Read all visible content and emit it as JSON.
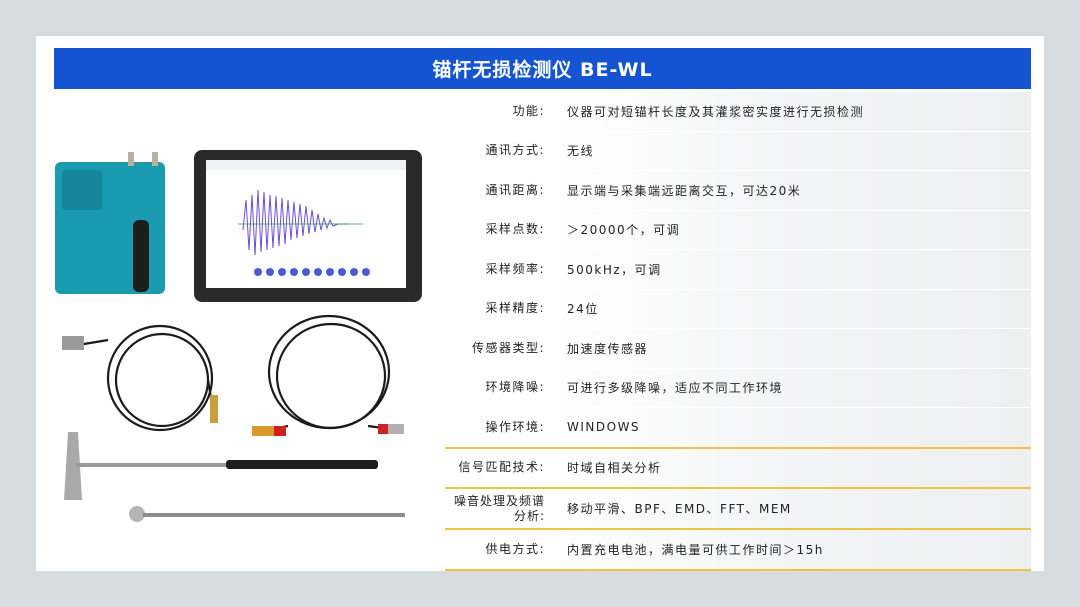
{
  "title": "锚杆无损检测仪 BE-WL",
  "specs": [
    {
      "key": "功能:",
      "value": "仪器可对短锚杆长度及其灌浆密实度进行无损检测"
    },
    {
      "key": "通讯方式:",
      "value": "无线"
    },
    {
      "key": "通讯距离:",
      "value": "显示端与采集端远距离交互，可达20米"
    },
    {
      "key": "采样点数:",
      "value": "＞20000个，可调"
    },
    {
      "key": "采样频率:",
      "value": "500kHz，可调"
    },
    {
      "key": "采样精度:",
      "value": "24位"
    },
    {
      "key": "传感器类型:",
      "value": "加速度传感器"
    },
    {
      "key": "环境降噪:",
      "value": "可进行多级降噪，适应不同工作环境"
    },
    {
      "key": "操作环境:",
      "value": "WINDOWS"
    },
    {
      "key": "信号匹配技术:",
      "value": "时域自相关分析"
    },
    {
      "key": "噪音处理及频谱分析:",
      "value": "移动平滑、BPF、EMD、FFT、MEM"
    },
    {
      "key": "供电方式:",
      "value": "内置充电电池，满电量可供工作时间＞15h"
    }
  ],
  "colors": {
    "banner": "#1454d3",
    "accent_line": "#f1c43f"
  }
}
